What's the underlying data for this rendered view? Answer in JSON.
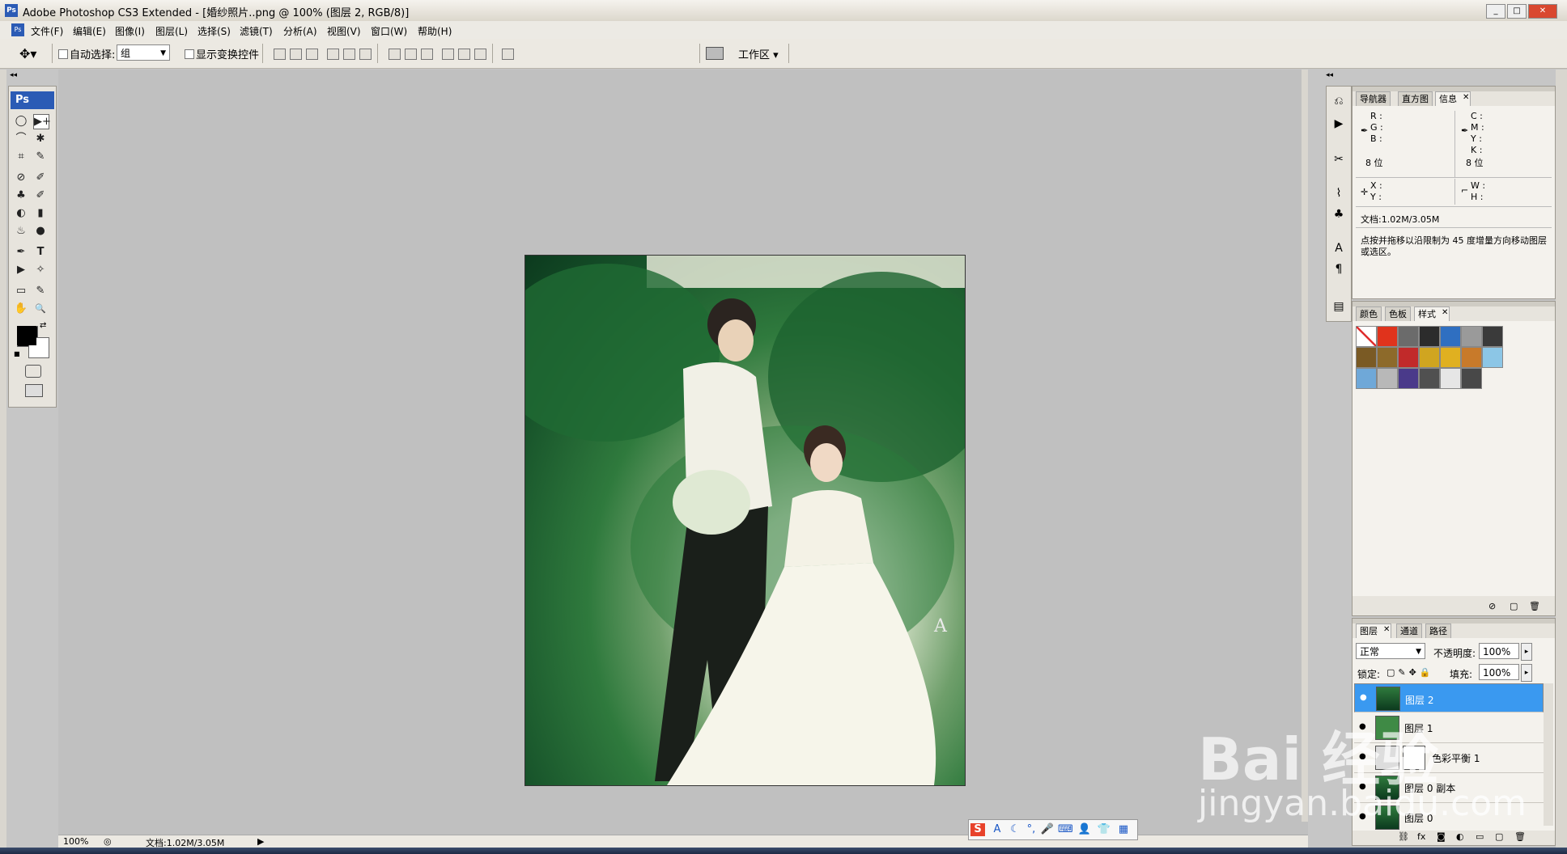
{
  "window": {
    "title": "Adobe Photoshop CS3 Extended - [婚纱照片..png @ 100% (图层 2, RGB/8)]",
    "app_icon": "Ps",
    "min_label": "_",
    "max_label": "□",
    "close_label": "✕"
  },
  "menu": {
    "items": [
      "文件(F)",
      "编辑(E)",
      "图像(I)",
      "图层(L)",
      "选择(S)",
      "滤镜(T)",
      "分析(A)",
      "视图(V)",
      "窗口(W)",
      "帮助(H)"
    ]
  },
  "options": {
    "auto_select_label": "自动选择:",
    "auto_select_value": "组",
    "show_transform_label": "显示变换控件",
    "workspace_label": "工作区 ▾"
  },
  "toolbox": {
    "header": "Ps",
    "tools": [
      "◯",
      "▶+",
      "⌒",
      "✱",
      "⌗",
      "✎",
      "⊘",
      "✐",
      "♣",
      "✐",
      "◐",
      "▮",
      "♨",
      "●",
      "✒",
      "T",
      "▶",
      "✧",
      "▭",
      "✎",
      "✋",
      "🔍"
    ]
  },
  "status": {
    "zoom": "100%",
    "doc": "文档:1.02M/3.05M"
  },
  "info_panel": {
    "tabs": [
      "导航器",
      "直方图",
      "信息"
    ],
    "r": "R :",
    "g": "G :",
    "b": "B :",
    "c": "C :",
    "m": "M :",
    "y": "Y :",
    "k": "K :",
    "bits_left": "8 位",
    "bits_right": "8 位",
    "x": "X :",
    "y2": "Y :",
    "w": "W :",
    "h": "H :",
    "doc": "文档:1.02M/3.05M",
    "hint": "点按并拖移以沿限制为 45 度增量方向移动图层或选区。"
  },
  "styles_panel": {
    "tabs": [
      "颜色",
      "色板",
      "样式"
    ],
    "swatches": [
      "#ffffff",
      "#e0331c",
      "#6b6b6b",
      "#2c2c2c",
      "#2f6fc1",
      "#9a9a9a",
      "#3a3a3a",
      "#7a5a24",
      "#8d6a2a",
      "#c12a2a",
      "#d0a520",
      "#e0b020",
      "#c87a2a",
      "#8cc6e6",
      "#6fa8d8",
      "#b8b8b8",
      "#4a3a8a",
      "#505050",
      "#e6e6e6",
      "#484848"
    ]
  },
  "layers_panel": {
    "tabs": [
      "图层",
      "通道",
      "路径"
    ],
    "blend_mode": "正常",
    "opacity_label": "不透明度:",
    "opacity_value": "100%",
    "lock_label": "锁定:",
    "fill_label": "填充:",
    "fill_value": "100%",
    "layers": [
      {
        "name": "图层 2"
      },
      {
        "name": "图层 1"
      },
      {
        "name": "色彩平衡 1"
      },
      {
        "name": "图层 0 副本"
      },
      {
        "name": "图层 0"
      }
    ]
  },
  "watermark": {
    "brand": "Bai 经验",
    "url": "jingyan.baidu.com"
  },
  "ime": {
    "logo": "S",
    "icons": [
      "A",
      "☾",
      "°,",
      "🎤",
      "⌨",
      "👤",
      "👕",
      "▦"
    ]
  },
  "colors": {
    "accent": "#2b5bb5",
    "selected_layer": "#3a99f0"
  }
}
